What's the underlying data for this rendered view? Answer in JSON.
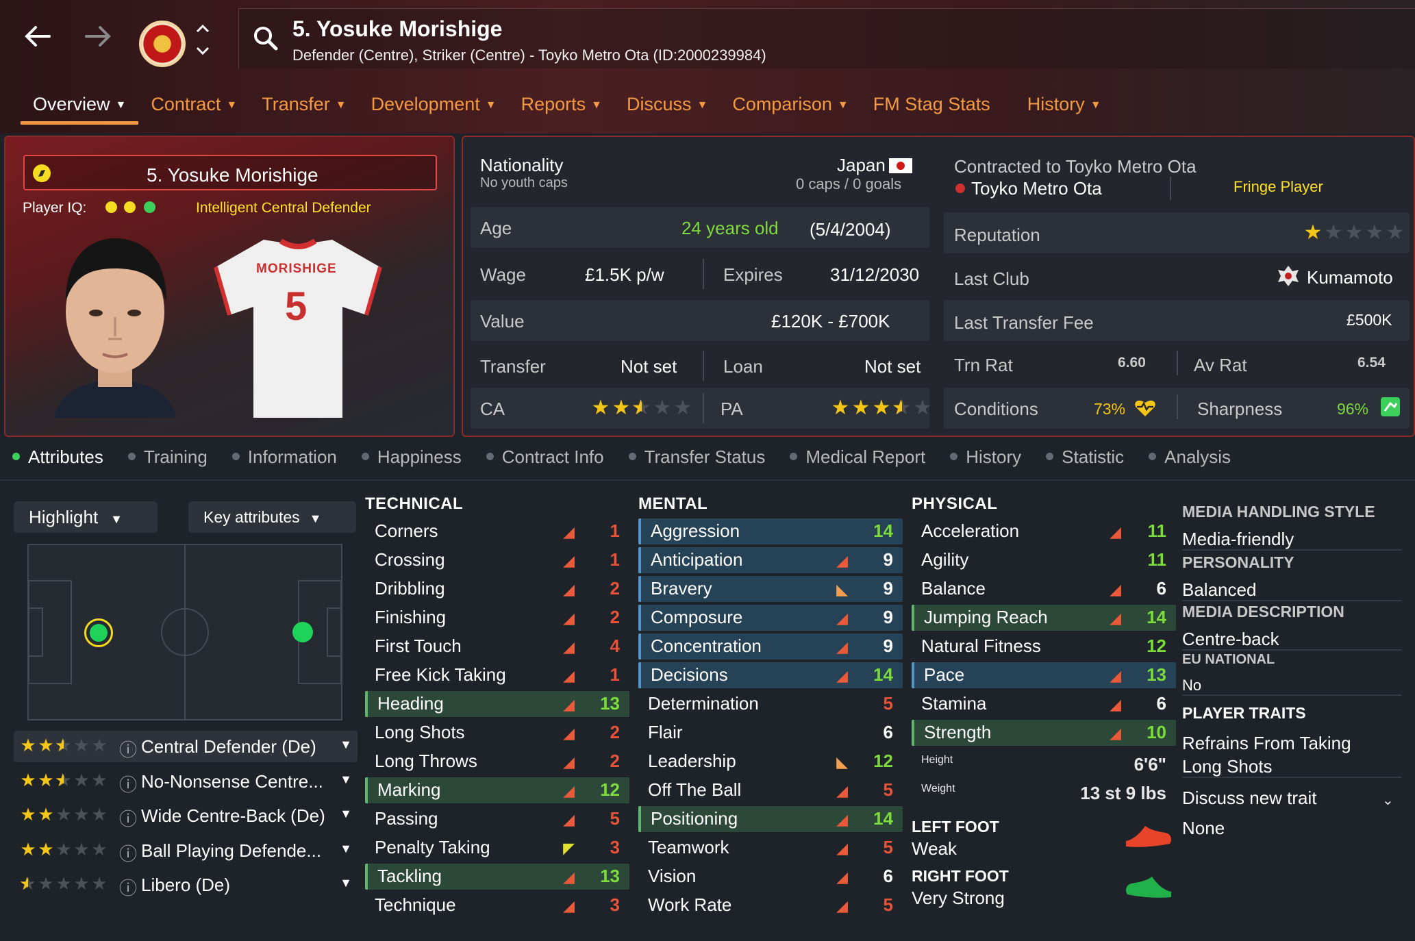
{
  "header": {
    "player_title": "5. Yosuke Morishige",
    "player_subtitle": "Defender (Centre), Striker (Centre) - Toyko Metro Ota (ID:2000239984)"
  },
  "tabs": [
    {
      "label": "Overview"
    },
    {
      "label": "Contract"
    },
    {
      "label": "Transfer"
    },
    {
      "label": "Development"
    },
    {
      "label": "Reports"
    },
    {
      "label": "Discuss"
    },
    {
      "label": "Comparison"
    },
    {
      "label": "FM Stag Stats"
    },
    {
      "label": "History"
    }
  ],
  "profile": {
    "name": "5. Yosuke Morishige",
    "iq_label": "Player IQ:",
    "iq_desc": "Intelligent  Central Defender",
    "shirt_name": "MORISHIGE",
    "shirt_number": "5"
  },
  "info": {
    "nationality_label": "Nationality",
    "nationality": "Japan",
    "youth_caps": "No youth caps",
    "caps_goals": "0 caps / 0 goals",
    "age_label": "Age",
    "age": "24 years old",
    "dob": "(5/4/2004)",
    "wage_label": "Wage",
    "wage": "£1.5K p/w",
    "expires_label": "Expires",
    "expires": "31/12/2030",
    "value_label": "Value",
    "value": "£120K - £700K",
    "transfer_label": "Transfer",
    "transfer": "Not set",
    "loan_label": "Loan",
    "loan": "Not set",
    "ca_label": "CA",
    "ca_stars": 2.5,
    "pa_label": "PA",
    "pa_stars": 3.5,
    "contracted_label": "Contracted to Toyko Metro Ota",
    "club": "Toyko Metro Ota",
    "squad_status": "Fringe Player",
    "reputation_label": "Reputation",
    "reputation_stars": 1,
    "last_club_label": "Last Club",
    "last_club": "Kumamoto",
    "last_fee_label": "Last Transfer Fee",
    "last_fee": "£500K",
    "trn_label": "Trn Rat",
    "trn": "6.60",
    "av_label": "Av Rat",
    "av": "6.54",
    "conditions_label": "Conditions",
    "conditions": "73%",
    "sharpness_label": "Sharpness",
    "sharpness": "96%"
  },
  "subtabs": [
    {
      "label": "Attributes"
    },
    {
      "label": "Training"
    },
    {
      "label": "Information"
    },
    {
      "label": "Happiness"
    },
    {
      "label": "Contract Info"
    },
    {
      "label": "Transfer Status"
    },
    {
      "label": "Medical Report"
    },
    {
      "label": "History"
    },
    {
      "label": "Statistic"
    },
    {
      "label": "Analysis"
    }
  ],
  "controls": {
    "highlight": "Highlight",
    "key_attributes": "Key attributes"
  },
  "roles": [
    {
      "label": "Central Defender (De)",
      "stars": 2.5
    },
    {
      "label": "No-Nonsense Centre...",
      "stars": 2.5
    },
    {
      "label": "Wide Centre-Back (De)",
      "stars": 2
    },
    {
      "label": "Ball Playing Defende...",
      "stars": 2
    },
    {
      "label": "Libero (De)",
      "stars": 0.5
    }
  ],
  "attributes": {
    "technical_title": "TECHNICAL",
    "technical": [
      [
        "Corners",
        1,
        "down",
        "none"
      ],
      [
        "Crossing",
        1,
        "down",
        "none"
      ],
      [
        "Dribbling",
        2,
        "down",
        "none"
      ],
      [
        "Finishing",
        2,
        "down",
        "none"
      ],
      [
        "First Touch",
        4,
        "down",
        "none"
      ],
      [
        "Free Kick Taking",
        1,
        "down",
        "none"
      ],
      [
        "Heading",
        13,
        "down",
        "green"
      ],
      [
        "Long Shots",
        2,
        "down",
        "none"
      ],
      [
        "Long Throws",
        2,
        "down",
        "none"
      ],
      [
        "Marking",
        12,
        "down",
        "green"
      ],
      [
        "Passing",
        5,
        "down",
        "none"
      ],
      [
        "Penalty Taking",
        3,
        "yellow",
        "none"
      ],
      [
        "Tackling",
        13,
        "down",
        "green"
      ],
      [
        "Technique",
        3,
        "down",
        "none"
      ]
    ],
    "mental_title": "MENTAL",
    "mental": [
      [
        "Aggression",
        14,
        "none",
        "blue"
      ],
      [
        "Anticipation",
        9,
        "down",
        "blue"
      ],
      [
        "Bravery",
        9,
        "up",
        "blue"
      ],
      [
        "Composure",
        9,
        "down",
        "blue"
      ],
      [
        "Concentration",
        9,
        "down",
        "blue"
      ],
      [
        "Decisions",
        14,
        "down",
        "blue"
      ],
      [
        "Determination",
        5,
        "none",
        "none"
      ],
      [
        "Flair",
        6,
        "none",
        "none"
      ],
      [
        "Leadership",
        12,
        "up",
        "none"
      ],
      [
        "Off The Ball",
        5,
        "down",
        "none"
      ],
      [
        "Positioning",
        14,
        "down",
        "green"
      ],
      [
        "Teamwork",
        5,
        "down",
        "none"
      ],
      [
        "Vision",
        6,
        "down",
        "none"
      ],
      [
        "Work Rate",
        5,
        "down",
        "none"
      ]
    ],
    "physical_title": "PHYSICAL",
    "physical": [
      [
        "Acceleration",
        11,
        "down",
        "none"
      ],
      [
        "Agility",
        11,
        "none",
        "none"
      ],
      [
        "Balance",
        6,
        "down",
        "none"
      ],
      [
        "Jumping Reach",
        14,
        "down",
        "green"
      ],
      [
        "Natural Fitness",
        12,
        "none",
        "none"
      ],
      [
        "Pace",
        13,
        "down",
        "blue"
      ],
      [
        "Stamina",
        6,
        "down",
        "none"
      ],
      [
        "Strength",
        10,
        "down",
        "green"
      ]
    ],
    "height_label": "Height",
    "height": "6'6\"",
    "weight_label": "Weight",
    "weight": "13 st 9 lbs",
    "left_foot_label": "LEFT FOOT",
    "left_foot": "Weak",
    "right_foot_label": "RIGHT FOOT",
    "right_foot": "Very Strong"
  },
  "right_info": {
    "media_style_label": "MEDIA HANDLING STYLE",
    "media_style": "Media-friendly",
    "personality_label": "PERSONALITY",
    "personality": "Balanced",
    "media_desc_label": "MEDIA DESCRIPTION",
    "media_desc": "Centre-back",
    "eu_label": "EU NATIONAL",
    "eu": "No",
    "traits_label": "PLAYER TRAITS",
    "trait_1": "Refrains From Taking",
    "trait_2": "Long Shots",
    "discuss_trait": "Discuss new trait",
    "none": "None"
  },
  "colors": {
    "accent": "#f39a42",
    "green": "#7ddc3c",
    "red_value": "#e8533a",
    "panel_border": "#8a2a2a"
  }
}
